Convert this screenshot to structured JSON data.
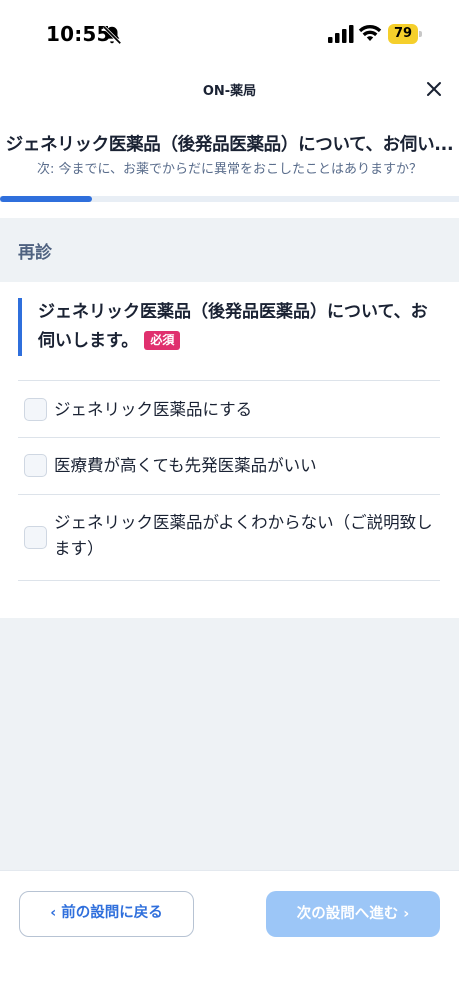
{
  "status_bar": {
    "time": "10:55",
    "battery": "79",
    "icons": [
      "bell-slash-icon",
      "signal-icon",
      "wifi-icon",
      "battery-icon"
    ]
  },
  "nav": {
    "title": "ON-薬局",
    "close_icon": "close-icon"
  },
  "header": {
    "title": "ジェネリック医薬品（後発品医薬品）について、お伺い...",
    "next_question": "次: 今までに、お薬でからだに異常をおこしたことはありますか？"
  },
  "progress": {
    "fraction": 0.2
  },
  "section": {
    "label": "再診"
  },
  "question": {
    "text": "ジェネリック医薬品（後発品医薬品）について、お伺いします。",
    "required_badge": "必須",
    "options": [
      {
        "label": "ジェネリック医薬品にする",
        "checked": false
      },
      {
        "label": "医療費が高くても先発医薬品がいい",
        "checked": false
      },
      {
        "label": "ジェネリック医薬品がよくわからない（ご説明致します）",
        "checked": false
      }
    ]
  },
  "footer": {
    "prev_label": "前の設問に戻る",
    "prev_icon": "chevron-left-icon",
    "next_label": "次の設問へ進む",
    "next_icon": "chevron-right-icon"
  },
  "colors": {
    "accent": "#2f6fdc",
    "required": "#e0306e",
    "next_disabled": "#9cc6f7",
    "band": "#eef2f5"
  }
}
